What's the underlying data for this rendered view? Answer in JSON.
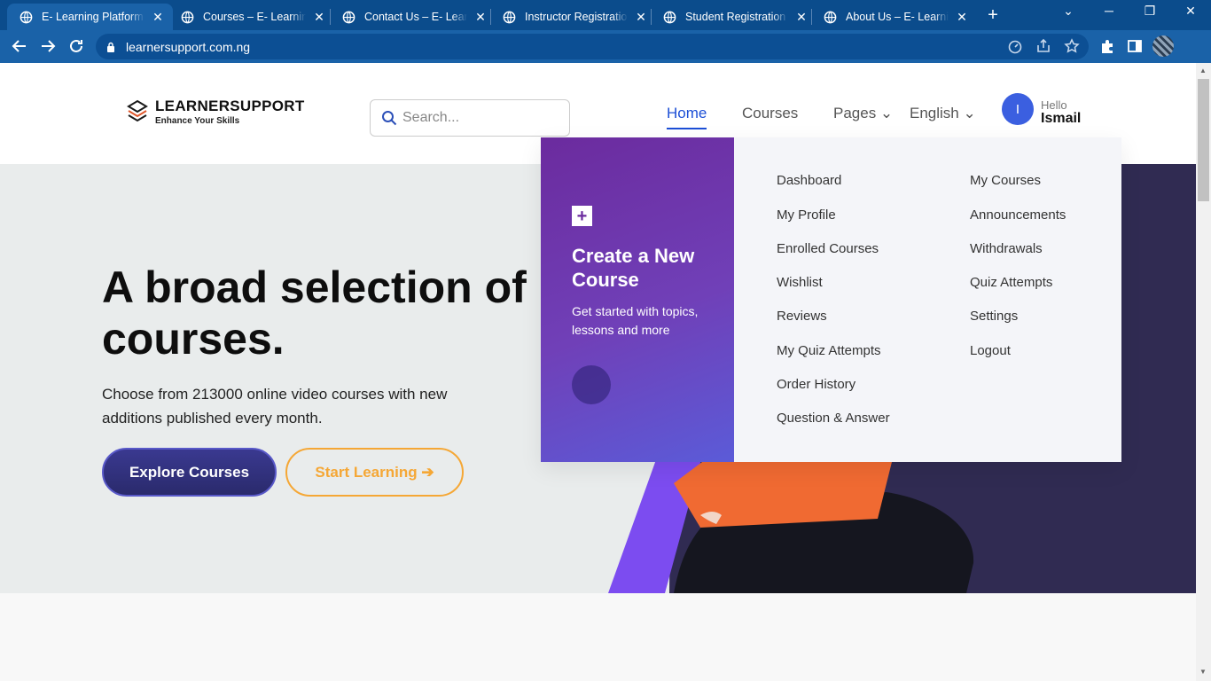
{
  "browser": {
    "tabs": [
      {
        "label": "E- Learning Platform –"
      },
      {
        "label": "Courses – E- Learning"
      },
      {
        "label": "Contact Us – E- Learni"
      },
      {
        "label": "Instructor Registration"
      },
      {
        "label": "Student Registration –"
      },
      {
        "label": "About Us – E- Learning"
      }
    ],
    "new_tab": "+",
    "url": "learnersupport.com.ng"
  },
  "header": {
    "brand": "LEARNERSUPPORT",
    "tagline": "Enhance Your Skills",
    "search_placeholder": "Search...",
    "nav": {
      "home": "Home",
      "courses": "Courses",
      "pages": "Pages ⌄",
      "language": "English ⌄"
    },
    "user": {
      "initial": "I",
      "greeting": "Hello",
      "name": "Ismail"
    }
  },
  "hero": {
    "headline": "A broad selection of courses.",
    "description": "Choose from 213000 online video courses with new additions published every month.",
    "explore_label": "Explore Courses",
    "start_label": "Start Learning ➔"
  },
  "dropdown": {
    "create_icon": "+",
    "create_title": "Create a New Course",
    "create_sub": "Get started with topics, lessons and more",
    "col1": [
      "Dashboard",
      "My Profile",
      "Enrolled Courses",
      "Wishlist",
      "Reviews",
      "My Quiz Attempts",
      "Order History",
      "Question & Answer"
    ],
    "col2": [
      "My Courses",
      "Announcements",
      "Withdrawals",
      "Quiz Attempts",
      "Settings",
      "Logout"
    ]
  },
  "colors": {
    "accent": "#1c4fd6",
    "browser": "#1a62a8",
    "cta_orange": "#f5a735",
    "purple": "#6b2b9e"
  }
}
